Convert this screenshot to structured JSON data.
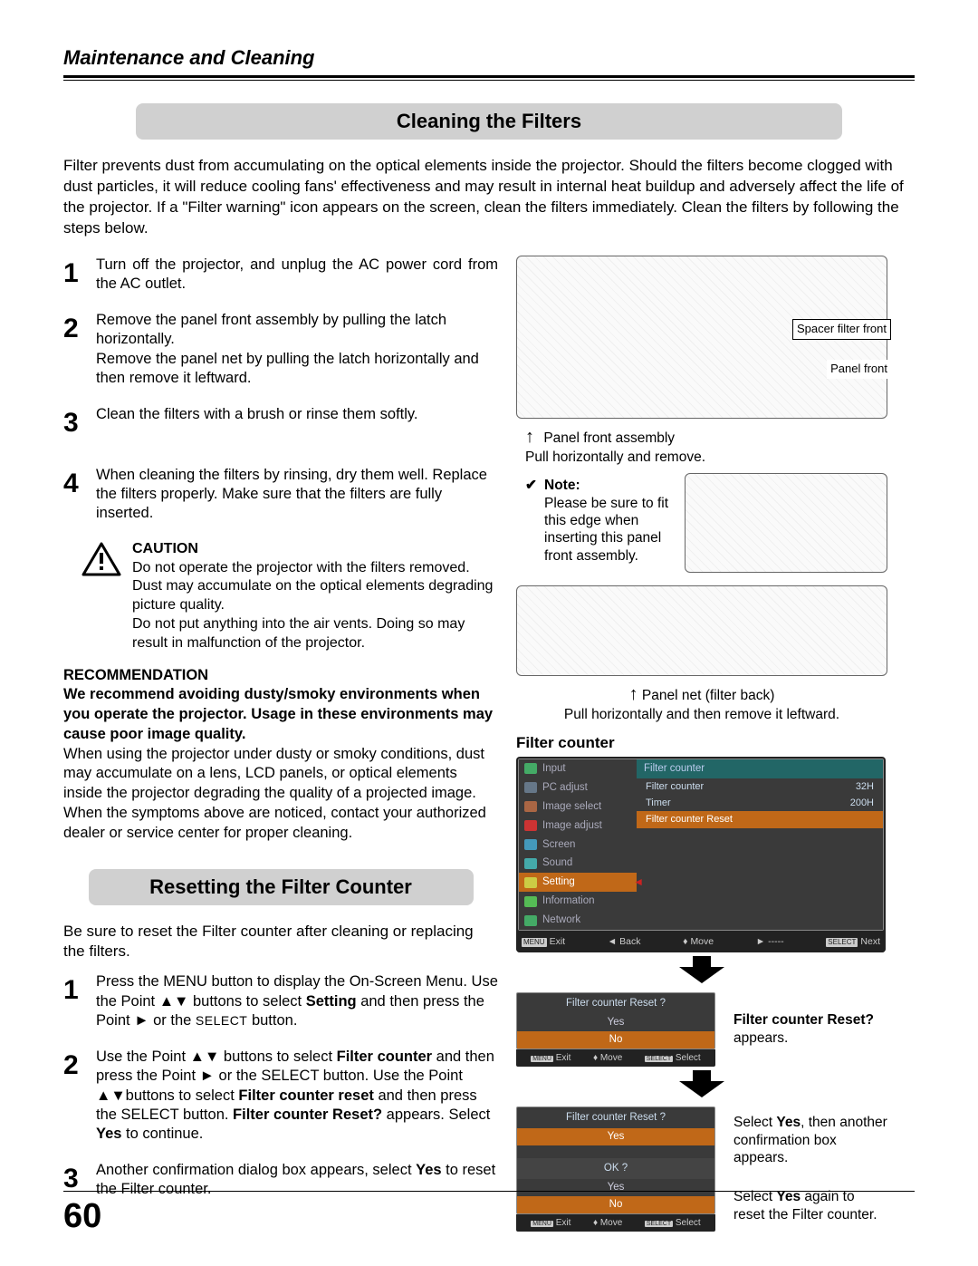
{
  "chapter": "Maintenance and Cleaning",
  "page_number": "60",
  "section1": {
    "title": "Cleaning the Filters",
    "intro": "Filter prevents dust from accumulating on the optical elements inside the projector. Should the filters become clogged with dust particles, it will reduce cooling fans' effectiveness and may result in internal heat buildup and adversely affect the life of the projector. If a \"Filter warning\" icon appears on the screen, clean the filters immediately. Clean the filters by following the steps below.",
    "steps": [
      "Turn off the projector, and unplug the AC power cord from the AC outlet.",
      "Remove the panel front assembly by pulling the latch horizontally.\nRemove the panel net  by pulling the latch horizontally and then remove it leftward.",
      "Clean the filters with a brush or rinse them softly.",
      "When cleaning the filters by rinsing, dry them well. Replace the filters properly.  Make sure that the filters are fully inserted."
    ],
    "caution_title": "CAUTION",
    "caution": "Do not operate the projector with the filters removed. Dust may accumulate on the optical elements degrading picture quality.\nDo not put anything into the air vents. Doing so may result in malfunction of the projector.",
    "rec_title": "RECOMMENDATION",
    "rec_strong": "We recommend avoiding dusty/smoky environments when you operate the projector. Usage in these environments may cause poor image quality.",
    "rec_body": "When using the projector under dusty or smoky conditions, dust may accumulate on a lens, LCD panels, or optical elements inside the projector degrading the quality of a projected image. When the symptoms above are noticed, contact your authorized dealer or service center for proper cleaning."
  },
  "diagram1": {
    "spacer_label": "Spacer filter front",
    "panel_front_label": "Panel front",
    "assembly_label": "Panel front assembly",
    "pull_label": "Pull horizontally and remove.",
    "note_prefix": "✔",
    "note_title": "Note",
    "note_body": "Please be sure to fit this edge when inserting this panel front assembly.",
    "panel_net_label": "Panel net (filter back)",
    "panel_net_pull": "Pull horizontally and then remove it leftward."
  },
  "section2": {
    "title": "Resetting the Filter Counter",
    "intro": "Be sure to reset the Filter counter after cleaning or replacing the filters.",
    "step1_a": "Press the MENU button to display the On-Screen Menu. Use the Point ▲▼ buttons to select ",
    "step1_b": "Setting",
    "step1_c": " and then press the Point ► or the ",
    "step1_d": "SELECT",
    "step1_e": "  button.",
    "step2_a": "Use the Point ▲▼ buttons to select ",
    "step2_b": "Filter counter",
    "step2_c": " and then press the Point ► or the SELECT button. Use the Point ▲▼buttons to select ",
    "step2_d": "Filter counter reset",
    "step2_e": " and then press the SELECT button. ",
    "step2_f": "Filter counter Reset?",
    "step2_g": " appears. Select ",
    "step2_h": "Yes",
    "step2_i": " to continue.",
    "step3_a": "Another confirmation dialog box appears, select ",
    "step3_b": "Yes",
    "step3_c": " to reset the Filter counter."
  },
  "fc": {
    "heading": "Filter counter",
    "menu_left": [
      "Input",
      "PC adjust",
      "Image select",
      "Image adjust",
      "Screen",
      "Sound",
      "Setting",
      "Information",
      "Network"
    ],
    "menu_right_header": "Filter counter",
    "menu_right": [
      {
        "label": "Filter counter",
        "val": "32H"
      },
      {
        "label": "Timer",
        "val": "200H"
      },
      {
        "label": "Filter counter Reset",
        "val": ""
      }
    ],
    "footer": {
      "exit": "Exit",
      "back": "Back",
      "move": "Move",
      "next": "Next",
      "select": "Select",
      "dash": "-----"
    },
    "dialog1": {
      "title": "Filter counter  Reset ?",
      "yes": "Yes",
      "no": "No"
    },
    "side1_a": "Filter counter Reset?",
    "side1_b": " appears.",
    "dialog2": {
      "title": "Filter counter  Reset ?",
      "yes": "Yes",
      "ok": "OK ?",
      "no": "No"
    },
    "side2_a": "Select ",
    "side2_b": "Yes",
    "side2_c": ", then another confirmation box appears.",
    "side3_a": "Select ",
    "side3_b": "Yes",
    "side3_c": " again to reset the Filter counter."
  },
  "icons": {
    "menu_badge": "MENU",
    "select_badge": "SELECT"
  }
}
